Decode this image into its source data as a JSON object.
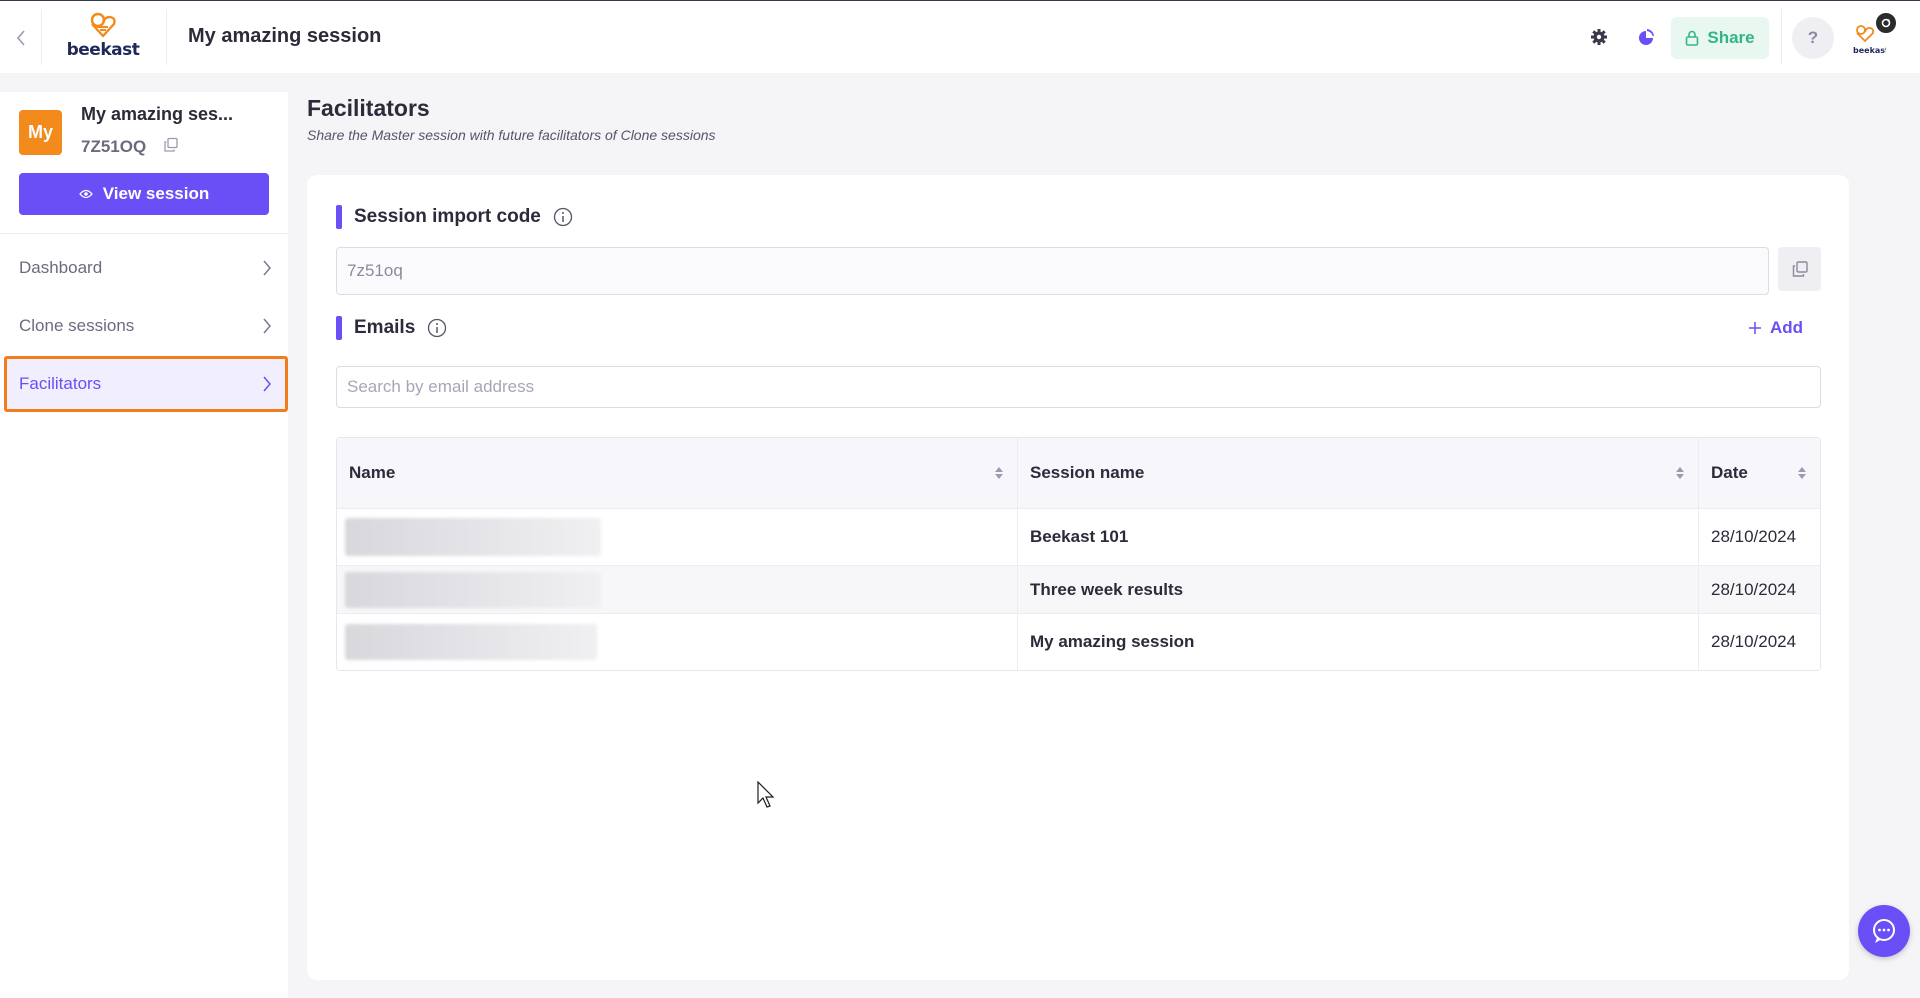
{
  "header": {
    "brand": "beekast",
    "session_title": "My amazing session",
    "share_label": "Share",
    "help_label": "?",
    "avatar_brand": "beekast"
  },
  "sidebar": {
    "avatar_initials": "My",
    "session_name": "My amazing ses...",
    "session_code": "7Z51OQ",
    "view_session_label": "View session",
    "items": [
      {
        "label": "Dashboard",
        "active": false
      },
      {
        "label": "Clone sessions",
        "active": false
      },
      {
        "label": "Facilitators",
        "active": true
      }
    ]
  },
  "main": {
    "heading": "Facilitators",
    "subtitle": "Share the Master session with future facilitators of Clone sessions",
    "import_code": {
      "label": "Session import code",
      "value": "7z51oq"
    },
    "emails": {
      "label": "Emails",
      "add_label": "Add",
      "search_placeholder": "Search by email address"
    },
    "table": {
      "columns": [
        "Name",
        "Session name",
        "Date"
      ],
      "rows": [
        {
          "name": "",
          "session": "Beekast 101",
          "date": "28/10/2024"
        },
        {
          "name": "",
          "session": "Three week results",
          "date": "28/10/2024"
        },
        {
          "name": "",
          "session": "My amazing session",
          "date": "28/10/2024"
        }
      ]
    }
  },
  "colors": {
    "accent": "#6a4ff6",
    "brand_orange": "#f28a1c",
    "share_green": "#35b584",
    "active_outline": "#f07d1a"
  },
  "icons": [
    "chevron-left-icon",
    "beekast-logo",
    "gear-icon",
    "pie-icon",
    "lock-icon",
    "help-icon",
    "eye-icon",
    "copy-icon",
    "chevron-right-icon",
    "info-icon",
    "plus-icon",
    "sort-icon",
    "chat-support-icon",
    "cursor-icon"
  ]
}
